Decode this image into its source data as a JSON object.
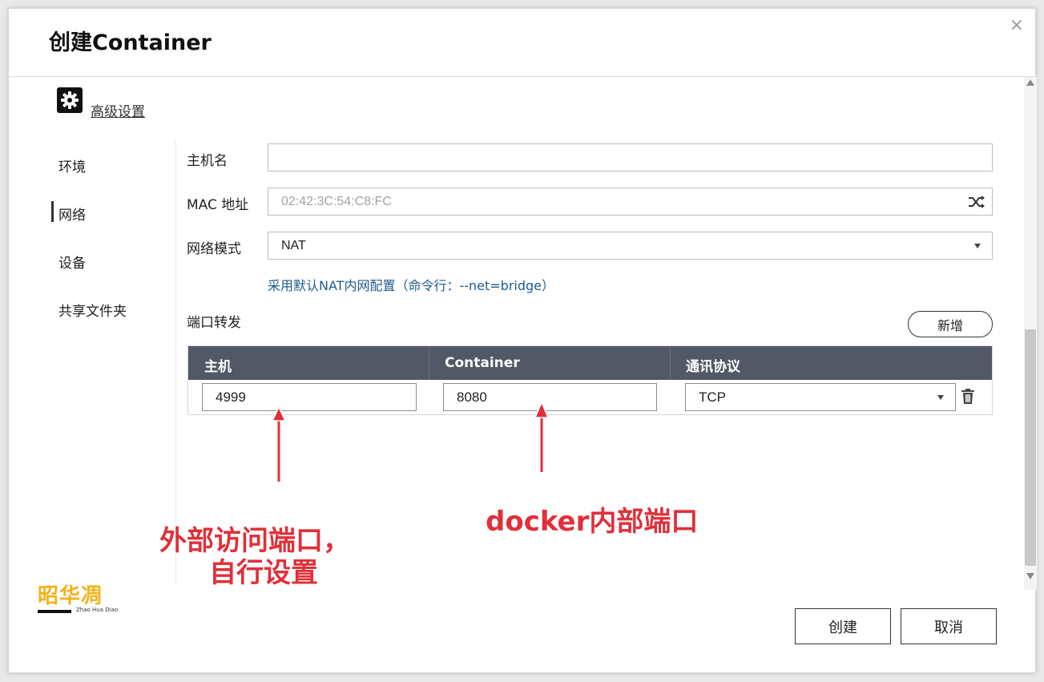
{
  "dialog": {
    "title": "创建Container",
    "close_glyph": "×"
  },
  "advanced": {
    "icon": "gear-icon",
    "label": "高级设置"
  },
  "nav": {
    "items": [
      "环境",
      "网络",
      "设备",
      "共享文件夹"
    ],
    "active": "网络"
  },
  "form": {
    "hostname": {
      "label": "主机名",
      "value": ""
    },
    "mac": {
      "label": "MAC 地址",
      "placeholder": "02:42:3C:54:C8:FC",
      "icon": "shuffle-icon"
    },
    "network_mode": {
      "label": "网络模式",
      "value": "NAT"
    },
    "hint": "采用默认NAT内网配置（命令行：--net=bridge）"
  },
  "port_forward": {
    "label": "端口转发",
    "add_button": "新增",
    "columns": [
      "主机",
      "Container",
      "通讯协议"
    ],
    "rows": [
      {
        "host": "4999",
        "container": "8080",
        "protocol": "TCP"
      }
    ]
  },
  "annotations": {
    "host_note_line1": "外部访问端口，",
    "host_note_line2": "自行设置",
    "container_note": "docker内部端口"
  },
  "logo": {
    "text": "昭华凋",
    "subtitle": "Zhao Hua Diao"
  },
  "footer": {
    "create": "创建",
    "cancel": "取消"
  },
  "colors": {
    "table_header": "#525866",
    "hint": "#1e5b8e",
    "annotation": "#e0303a",
    "logo": "#f3b21b"
  }
}
